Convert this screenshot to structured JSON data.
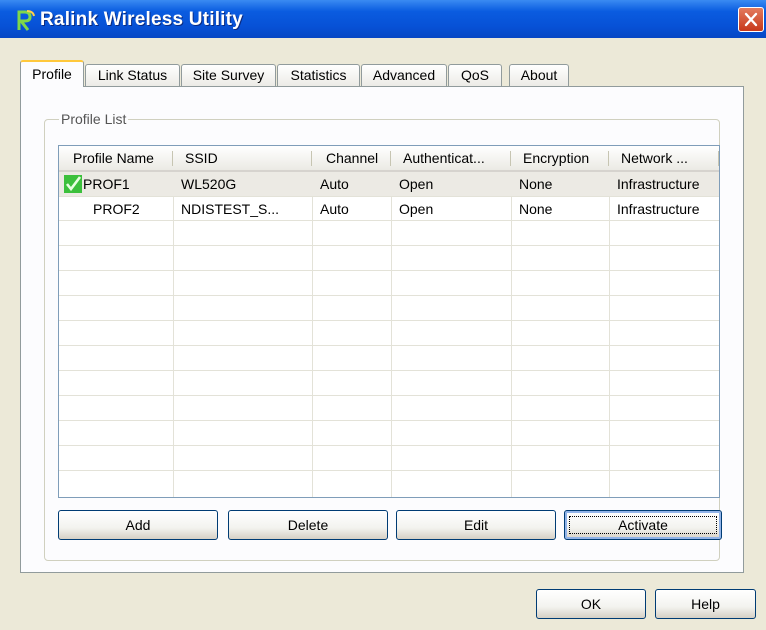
{
  "window": {
    "title": "Ralink Wireless Utility"
  },
  "tabs": [
    {
      "label": "Profile",
      "active": true
    },
    {
      "label": "Link Status"
    },
    {
      "label": "Site Survey"
    },
    {
      "label": "Statistics"
    },
    {
      "label": "Advanced"
    },
    {
      "label": "QoS"
    },
    {
      "label": "About"
    }
  ],
  "profile_list": {
    "group_label": "Profile List",
    "columns": [
      "Profile Name",
      "SSID",
      "Channel",
      "Authenticat...",
      "Encryption",
      "Network ..."
    ],
    "rows": [
      {
        "active": true,
        "profile_name": "PROF1",
        "ssid": "WL520G",
        "channel": "Auto",
        "authentication": "Open",
        "encryption": "None",
        "network": "Infrastructure"
      },
      {
        "active": false,
        "profile_name": "PROF2",
        "ssid": "NDISTEST_S...",
        "channel": "Auto",
        "authentication": "Open",
        "encryption": "None",
        "network": "Infrastructure"
      }
    ]
  },
  "actions": {
    "add": "Add",
    "delete": "Delete",
    "edit": "Edit",
    "activate": "Activate"
  },
  "dialog": {
    "ok": "OK",
    "help": "Help"
  },
  "icons": {
    "app": "ralink-logo-icon",
    "close": "close-icon",
    "active_profile": "check-icon"
  },
  "colors": {
    "titlebar": "#0a5ce0",
    "close_button": "#c7381a",
    "window_bg": "#ece9d8",
    "active_tab_accent": "#ffc83c"
  }
}
